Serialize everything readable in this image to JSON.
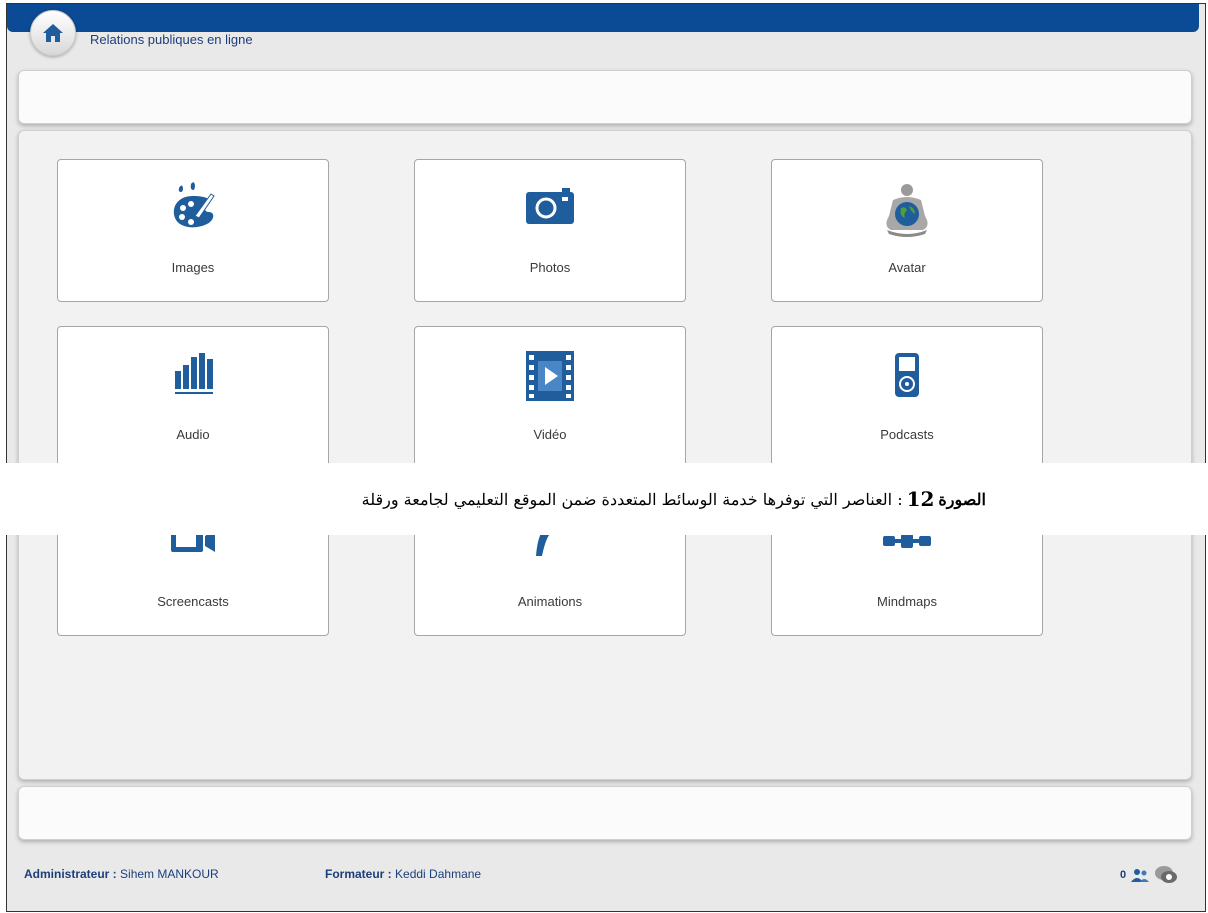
{
  "header": {
    "title": "Relations publiques en ligne",
    "home_icon": "home-icon"
  },
  "tiles": [
    {
      "label": "Images",
      "icon": "palette-icon"
    },
    {
      "label": "Photos",
      "icon": "camera-icon"
    },
    {
      "label": "Avatar",
      "icon": "avatar-globe-icon"
    },
    {
      "label": "Audio",
      "icon": "audio-bars-icon"
    },
    {
      "label": "Vidéo",
      "icon": "film-play-icon"
    },
    {
      "label": "Podcasts",
      "icon": "media-player-icon"
    },
    {
      "label": "Screencasts",
      "icon": "video-camera-icon"
    },
    {
      "label": "Animations",
      "icon": "curve-icon"
    },
    {
      "label": "Mindmaps",
      "icon": "node-map-icon"
    }
  ],
  "caption": {
    "label": "الصورة",
    "number": "12",
    "text": ": العناصر التي توفرها خدمة الوسائط المتعددة ضمن الموقع التعليمي لجامعة ورقلة"
  },
  "footer": {
    "admin_label": "Administrateur :",
    "admin_name": "Sihem MANKOUR",
    "trainer_label": "Formateur :",
    "trainer_name": "Keddi Dahmane",
    "online_count": "0"
  },
  "colors": {
    "brand_blue": "#0b4a95",
    "icon_blue": "#1f5d9c"
  }
}
